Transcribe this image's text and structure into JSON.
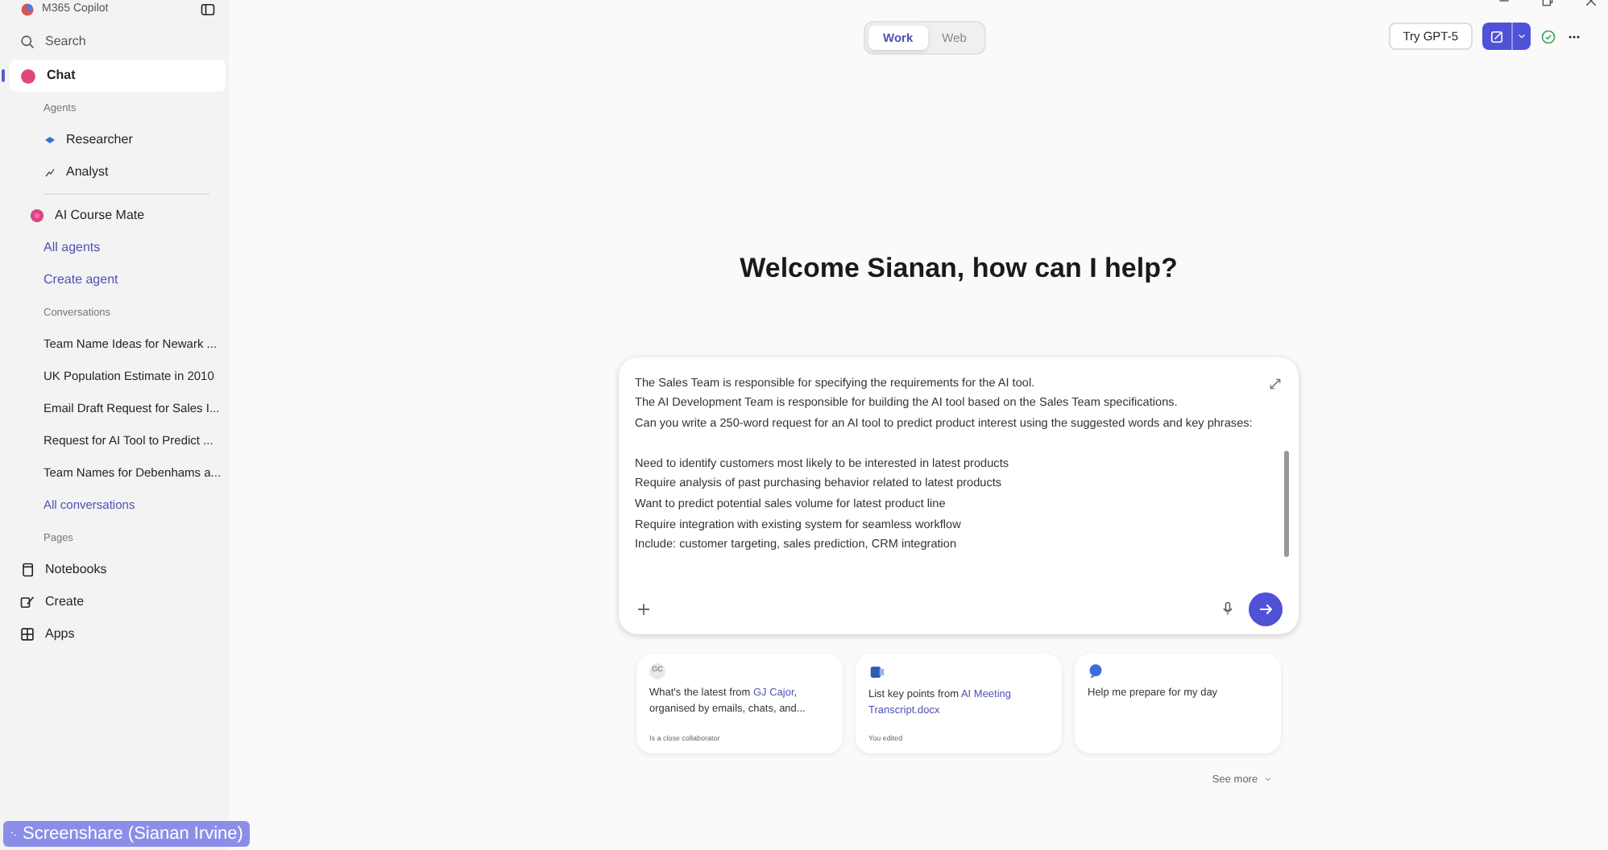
{
  "app_title": "M365 Copilot",
  "sidebar": {
    "search": "Search",
    "chat": {
      "label": "Chat",
      "selected": true
    },
    "agents_heading": "Agents",
    "agents": [
      {
        "label": "Researcher",
        "kind": "researcher"
      },
      {
        "label": "Analyst",
        "kind": "analyst"
      },
      {
        "label": "AI Course Mate",
        "kind": "custom"
      }
    ],
    "all_agents": "All agents",
    "create_agent": "Create agent",
    "conversations_heading": "Conversations",
    "conversations": [
      "Team Name Ideas for Newark ...",
      "UK Population Estimate in 2010",
      "Email Draft Request for Sales I...",
      "Request for AI Tool to Predict ...",
      "Team Names for Debenhams a..."
    ],
    "all_conversations": "All conversations",
    "pages_heading": "Pages",
    "pages": [
      {
        "label": "Notebooks",
        "kind": "notebook"
      },
      {
        "label": "Create",
        "kind": "create"
      },
      {
        "label": "Apps",
        "kind": "apps"
      }
    ]
  },
  "mode_tabs": [
    {
      "label": "Work",
      "selected": true
    },
    {
      "label": "Web",
      "selected": false
    }
  ],
  "try_button": "Try GPT-5",
  "welcome": "Welcome Sianan, how can I help?",
  "prompt_paragraphs": [
    [
      "The Sales Team is responsible for specifying the requirements for the AI tool.",
      "The AI Development Team is responsible for building the AI tool based on the Sales Team specifications.",
      "Can you write a 250-word request for an AI tool to predict product interest using the suggested words and key phrases:"
    ],
    [
      "Need to identify customers most likely to be interested in latest products",
      "Require analysis of past purchasing behavior related to latest products",
      "Want to predict potential sales volume for latest product line",
      "Require integration with existing system for seamless workflow",
      "Include: customer targeting, sales prediction, CRM integration"
    ]
  ],
  "suggestions": [
    {
      "kind": "person",
      "initials": "GC",
      "parts": [
        {
          "text": "What's the latest from ",
          "link": false
        },
        {
          "text": "GJ Cajor",
          "link": true
        },
        {
          "text": ", organised by emails, chats, and...",
          "link": false
        }
      ],
      "note": "Is a close collaborator"
    },
    {
      "kind": "document",
      "parts": [
        {
          "text": "List key points from ",
          "link": false
        },
        {
          "text": "AI Meeting Transcript.docx",
          "link": true
        }
      ],
      "note": "You edited"
    },
    {
      "kind": "chat",
      "parts": [
        {
          "text": "Help me prepare for my day",
          "link": false
        }
      ]
    }
  ],
  "see_more": "See more",
  "screenshare": "Screenshare (Sianan Irvine)"
}
